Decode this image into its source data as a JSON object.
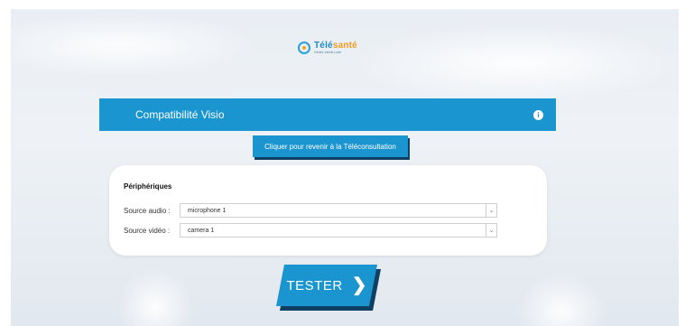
{
  "logo": {
    "title_main": "Télé",
    "title_accent": "santé",
    "subtitle": "Centre-Val de Loire"
  },
  "header": {
    "title": "Compatibilité Visio",
    "info_icon": "info-icon"
  },
  "back_button": {
    "label": "Cliquer pour revenir à la Téléconsultation"
  },
  "devices": {
    "title": "Périphériques",
    "audio": {
      "label": "Source audio :",
      "value": "microphone 1"
    },
    "video": {
      "label": "Source vidéo :",
      "value": "camera 1"
    }
  },
  "tester_button": {
    "label": "TESTER",
    "icon": "chevron-right-icon"
  },
  "colors": {
    "accent": "#1b95cf",
    "shadow": "#0f3f63",
    "brand_orange": "#f29a1b"
  }
}
